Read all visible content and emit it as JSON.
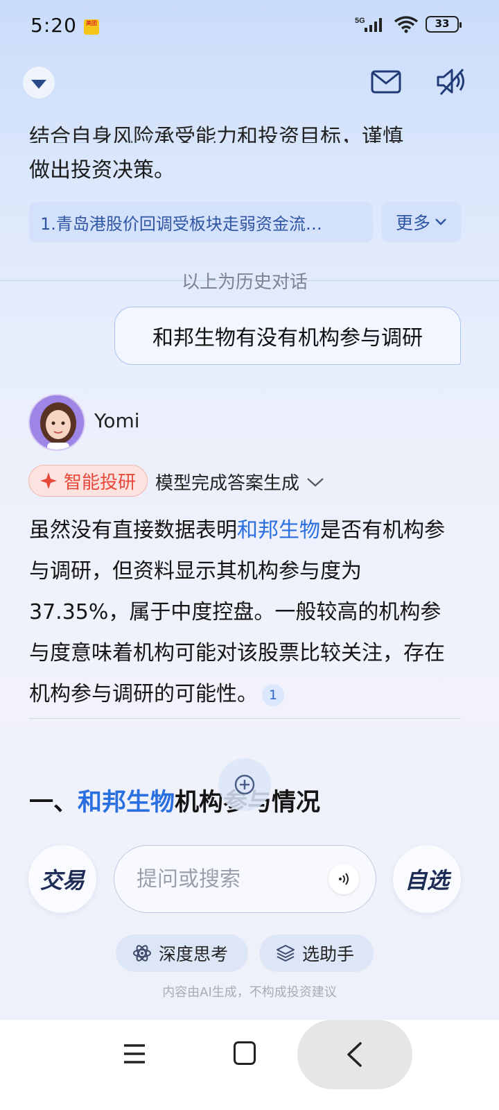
{
  "status_bar": {
    "time": "5:20",
    "app_badge": "美团",
    "network": "5G",
    "battery": "33"
  },
  "previous_answer": {
    "clipped_line": "结合自身风险承受能力和投资目标，谨慎",
    "last_line": "做出投资决策。",
    "reference": "1.青岛港股价回调受板块走弱资金流…",
    "more_label": "更多"
  },
  "history_label": "以上为历史对话",
  "user_message": "和邦生物有没有机构参与调研",
  "assistant": {
    "name": "Yomi",
    "badge": "智能投研",
    "status": "模型完成答案生成",
    "answer_parts": {
      "p1": "虽然没有直接数据表明",
      "highlight": "和邦生物",
      "p2": "是否有机构参与调研，但资料显示其机构参与度为37.35%，属于中度控盘。一般较高的机构参与度意味着机构可能对该股票比较关注，存在机构参与调研的可能性。",
      "citation": "1"
    },
    "section_title_prefix": "一、",
    "section_title_highlight": "和邦生物",
    "section_title_suffix": "机构参与情况"
  },
  "input_area": {
    "trade_label": "交易",
    "watchlist_label": "自选",
    "search_placeholder": "提问或搜索",
    "chips": [
      "深度思考",
      "选助手"
    ],
    "disclaimer": "内容由AI生成，不构成投资建议"
  },
  "colors": {
    "accent_blue": "#2a6fe0",
    "badge_red": "#e8483a"
  }
}
